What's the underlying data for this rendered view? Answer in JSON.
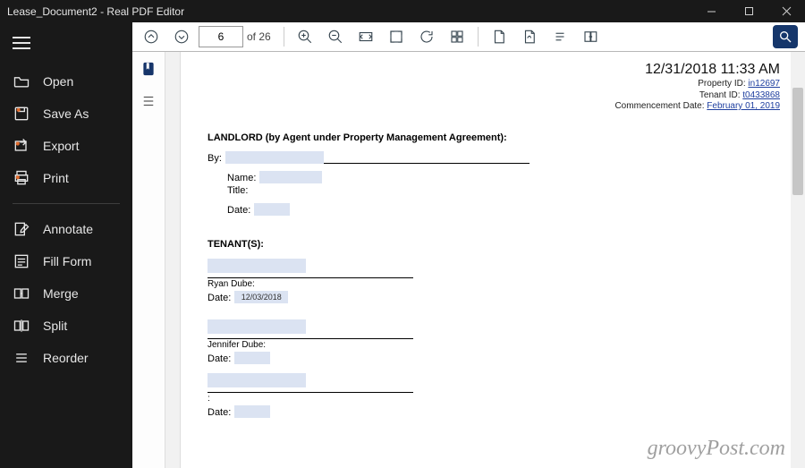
{
  "window": {
    "title": "Lease_Document2 - Real PDF Editor"
  },
  "sidebar": {
    "items": [
      {
        "label": "Open"
      },
      {
        "label": "Save As"
      },
      {
        "label": "Export"
      },
      {
        "label": "Print"
      },
      {
        "label": "Annotate"
      },
      {
        "label": "Fill Form"
      },
      {
        "label": "Merge"
      },
      {
        "label": "Split"
      },
      {
        "label": "Reorder"
      }
    ]
  },
  "toolbar": {
    "page_current": "6",
    "page_total_label": "of 26"
  },
  "document": {
    "header": {
      "datetime": "12/31/2018 11:33 AM",
      "property_label": "Property ID: ",
      "property_id": "in12697",
      "tenant_label": "Tenant ID: ",
      "tenant_id": "t0433868",
      "commencement_label": "Commencement Date: ",
      "commencement_date": "February 01, 2019"
    },
    "landlord_heading": "LANDLORD (by Agent under Property Management Agreement):",
    "by_label": "By:",
    "name_label": "Name:",
    "title_label": "Title:",
    "date_label": "Date:",
    "tenants_heading": "TENANT(S):",
    "tenant1_name": "Ryan Dube:",
    "tenant1_date_value": "12/03/2018",
    "tenant2_name": "Jennifer Dube:",
    "tenant3_name": ":"
  },
  "watermark": "groovyPost.com"
}
